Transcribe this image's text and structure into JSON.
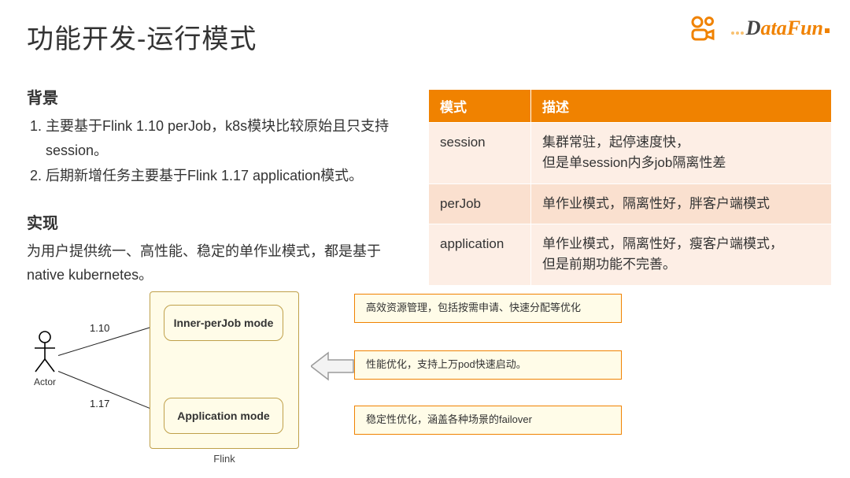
{
  "title": "功能开发-运行模式",
  "logos": {
    "datafun": "DataFun"
  },
  "left": {
    "bg_h": "背景",
    "bg_items": [
      "主要基于Flink 1.10 perJob，k8s模块比较原始且只支持session。",
      "后期新增任务主要基于Flink 1.17 application模式。"
    ],
    "impl_h": "实现",
    "impl_p": "为用户提供统一、高性能、稳定的单作业模式，都是基于native kubernetes。"
  },
  "table": {
    "head": [
      "模式",
      "描述"
    ],
    "rows": [
      [
        "session",
        "集群常驻，起停速度快，\n但是单session内多job隔离性差"
      ],
      [
        "perJob",
        "单作业模式，隔离性好，胖客户端模式"
      ],
      [
        "application",
        "单作业模式，隔离性好，瘦客户端模式，\n但是前期功能不完善。"
      ]
    ]
  },
  "diagram": {
    "actor": "Actor",
    "edge1": "1.10",
    "edge2": "1.17",
    "mode1": "Inner-perJob mode",
    "mode2": "Application mode",
    "group": "Flink",
    "notes": [
      "高效资源管理，包括按需申请、快速分配等优化",
      "性能优化，支持上万pod快速启动。",
      "稳定性优化，涵盖各种场景的failover"
    ]
  }
}
